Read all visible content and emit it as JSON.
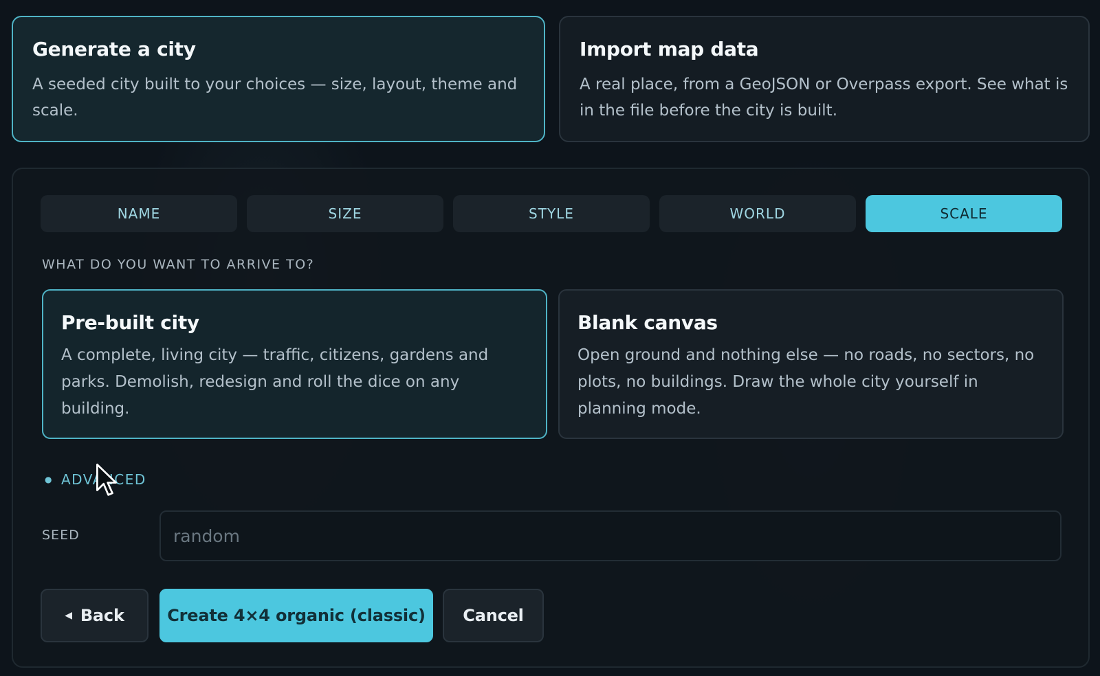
{
  "modes": [
    {
      "title": "Generate a city",
      "desc": "A seeded city built to your choices — size, layout, theme and scale.",
      "selected": true
    },
    {
      "title": "Import map data",
      "desc": "A real place, from a GeoJSON or Overpass export. See what is in the file before the city is built.",
      "selected": false
    }
  ],
  "tabs": [
    {
      "label": "NAME"
    },
    {
      "label": "SIZE"
    },
    {
      "label": "STYLE"
    },
    {
      "label": "WORLD"
    },
    {
      "label": "SCALE",
      "active": true
    }
  ],
  "question": "WHAT DO YOU WANT TO ARRIVE TO?",
  "options": [
    {
      "title": "Pre-built city",
      "desc": "A complete, living city — traffic, citizens, gardens and parks. Demolish, redesign and roll the dice on any building.",
      "selected": true
    },
    {
      "title": "Blank canvas",
      "desc": "Open ground and nothing else — no roads, no sectors, no plots, no buildings. Draw the whole city yourself in planning mode.",
      "selected": false
    }
  ],
  "advanced": {
    "label": "ADVANCED"
  },
  "seed": {
    "label": "SEED",
    "placeholder": "random",
    "value": ""
  },
  "buttons": {
    "back": "Back",
    "create": "Create 4×4 organic (classic)",
    "cancel": "Cancel"
  },
  "colors": {
    "accent": "#4cc7df",
    "background": "#0d141b"
  }
}
